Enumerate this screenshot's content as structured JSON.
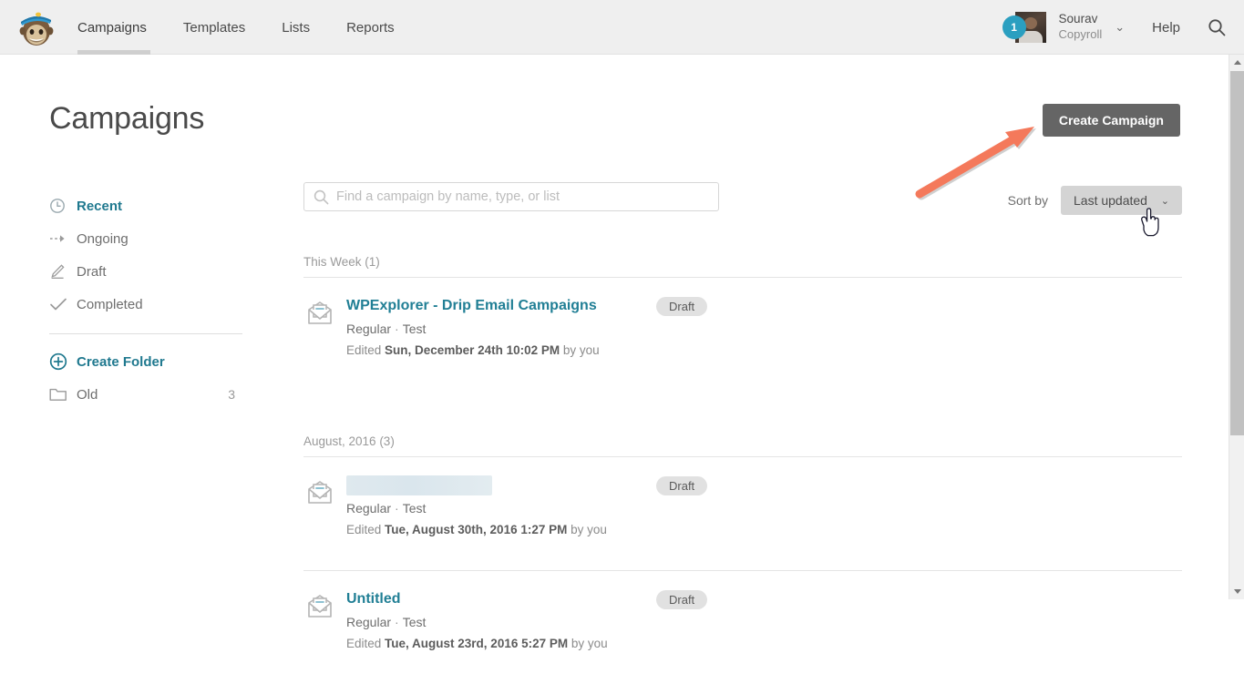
{
  "topbar": {
    "logo_alt": "mailchimp-freddie-logo",
    "nav": [
      {
        "label": "Campaigns",
        "active": true
      },
      {
        "label": "Templates",
        "active": false
      },
      {
        "label": "Lists",
        "active": false
      },
      {
        "label": "Reports",
        "active": false
      }
    ],
    "notification_count": "1",
    "user_name": "Sourav",
    "user_account": "Copyroll",
    "chevron": "⌄",
    "help_label": "Help",
    "accent_badge_color": "#2b9fc0"
  },
  "page": {
    "title": "Campaigns",
    "create_button": "Create Campaign"
  },
  "sidebar": {
    "items": [
      {
        "label": "Recent",
        "icon": "clock-icon",
        "active": true
      },
      {
        "label": "Ongoing",
        "icon": "arrow-dashed-icon",
        "active": false
      },
      {
        "label": "Draft",
        "icon": "pencil-icon",
        "active": false
      },
      {
        "label": "Completed",
        "icon": "check-icon",
        "active": false
      }
    ],
    "create_folder": {
      "label": "Create Folder",
      "icon": "plus-circle-icon"
    },
    "folders": [
      {
        "label": "Old",
        "icon": "folder-icon",
        "count": "3"
      }
    ],
    "accent_color": "#20798f"
  },
  "search": {
    "placeholder": "Find a campaign by name, type, or list",
    "value": ""
  },
  "sort": {
    "label": "Sort by",
    "selected": "Last updated",
    "chevron": "⌄",
    "options": [
      "Last updated"
    ]
  },
  "groups": [
    {
      "heading": "This Week (1)",
      "rows": [
        {
          "title": "WPExplorer - Drip Email Campaigns",
          "redacted": false,
          "type": "Regular",
          "separator": "·",
          "list": "Test",
          "edited_prefix": "Edited",
          "edited_date": "Sun, December 24th 10:02 PM",
          "edited_suffix": "by you",
          "status": "Draft"
        }
      ]
    },
    {
      "heading": "August, 2016 (3)",
      "rows": [
        {
          "title": "",
          "redacted": true,
          "type": "Regular",
          "separator": "·",
          "list": "Test",
          "edited_prefix": "Edited",
          "edited_date": "Tue, August 30th, 2016 1:27 PM",
          "edited_suffix": "by you",
          "status": "Draft"
        },
        {
          "title": "Untitled",
          "redacted": false,
          "type": "Regular",
          "separator": "·",
          "list": "Test",
          "edited_prefix": "Edited",
          "edited_date": "Tue, August 23rd, 2016 5:27 PM",
          "edited_suffix": "by you",
          "status": "Draft"
        }
      ]
    }
  ],
  "annotation": {
    "type": "arrow",
    "color": "#f4795b",
    "points_to": "create-campaign-button"
  },
  "cursor": {
    "type": "pointer-hand"
  }
}
